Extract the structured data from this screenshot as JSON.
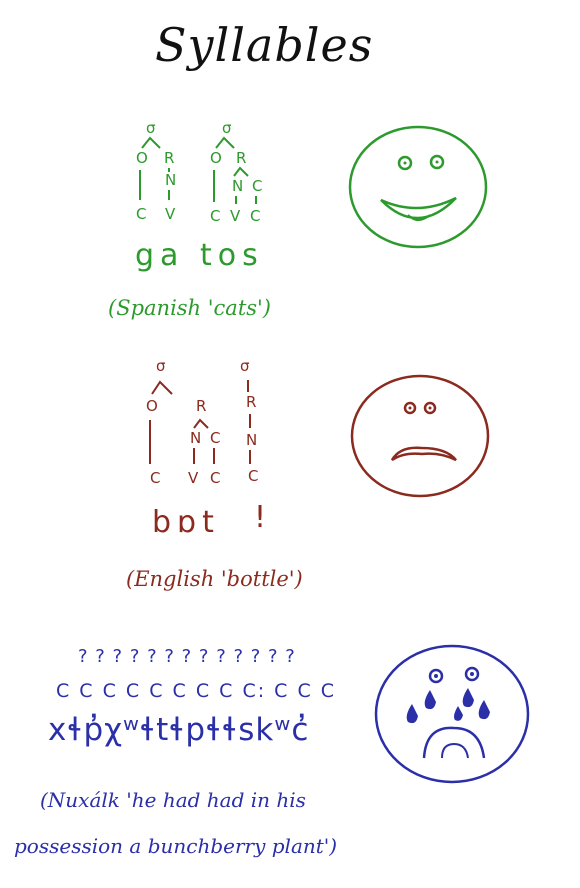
{
  "title": "Syllables",
  "spanish": {
    "word": "ga tos",
    "caption": "(Spanish 'cats')",
    "syl1": {
      "sigma": "σ",
      "onset": "O",
      "rime": "R",
      "nucleus": "N",
      "c1": "C",
      "v1": "V"
    },
    "syl2": {
      "sigma": "σ",
      "onset": "O",
      "rime": "R",
      "nucleus": "N",
      "coda": "C",
      "c1": "C",
      "v1": "V",
      "c2": "C"
    }
  },
  "english": {
    "word": "bɒt",
    "syllabic": "!",
    "caption": "(English 'bottle')",
    "syl1": {
      "sigma": "σ",
      "onset": "O",
      "rime": "R",
      "nucleus": "N",
      "coda": "C",
      "c1": "C",
      "v1": "V",
      "c2": "C"
    },
    "syl2": {
      "sigma": "σ",
      "rime": "R",
      "nucleus": "N",
      "c1": "C"
    }
  },
  "nuxalk": {
    "questions": "? ? ? ? ? ? ? ? ? ? ? ? ?",
    "cs": "C C C C   C C C C C: C C C",
    "word": "xɬp̓χʷɬtɬpɬɬskʷc̓",
    "caption_line1": "(Nuxálk 'he had had in his",
    "caption_line2": "possession a bunchberry plant')"
  },
  "colors": {
    "green": "#2d9a2d",
    "red": "#8b2a1e",
    "blue": "#2b2fa8"
  },
  "faces": [
    "happy-face-icon",
    "worried-face-icon",
    "crying-face-icon"
  ]
}
